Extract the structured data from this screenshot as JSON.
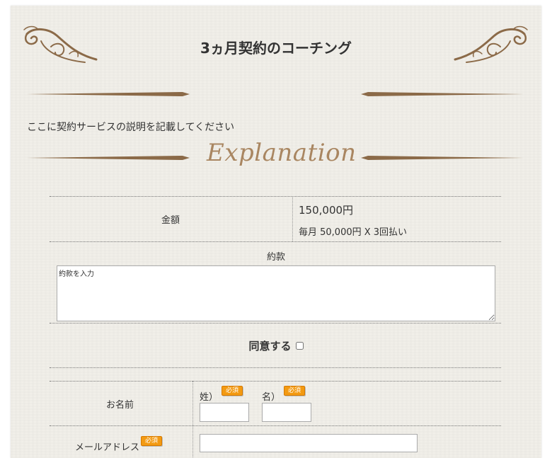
{
  "form": {
    "title": "3ヵ月契約のコーチング",
    "description": "ここに契約サービスの説明を記載してください",
    "explanation_heading": "Explanation",
    "price": {
      "label": "金額",
      "amount": "150,000円",
      "installments": "毎月 50,000円 X 3回払い"
    },
    "terms": {
      "label": "約款",
      "placeholder": "約款を入力"
    },
    "agree": {
      "label": "同意する",
      "checked": false
    },
    "name": {
      "label": "お名前",
      "last_label": "姓）",
      "first_label": "名）",
      "last_value": "",
      "first_value": ""
    },
    "email": {
      "label": "メールアドレス",
      "value": ""
    },
    "required_badge": "必須"
  },
  "colors": {
    "paper": "#f1efe9",
    "ornament": "#8b6a48",
    "explanation_text": "#a98661",
    "required_badge": "#f39a12"
  }
}
